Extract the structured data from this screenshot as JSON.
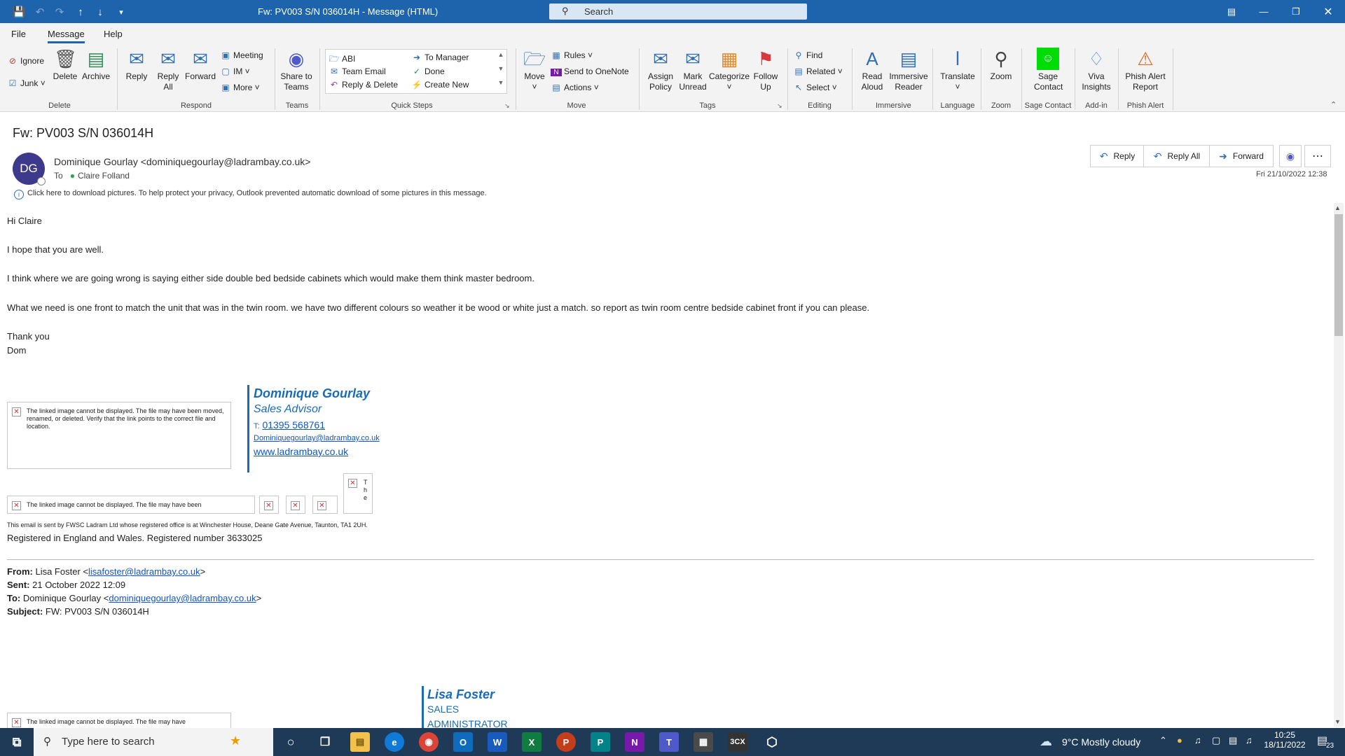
{
  "titlebar": {
    "title": "Fw: PV003 S/N 036014H  -  Message (HTML)",
    "search_placeholder": "Search"
  },
  "menu": {
    "tabs": [
      "File",
      "Message",
      "Help"
    ]
  },
  "ribbon": {
    "delete": {
      "ignore": "Ignore",
      "junk": "Junk",
      "delete": "Delete",
      "archive": "Archive",
      "label": "Delete"
    },
    "respond": {
      "reply": "Reply",
      "reply_all": "Reply All",
      "forward": "Forward",
      "meeting": "Meeting",
      "im": "IM",
      "more": "More",
      "label": "Respond"
    },
    "teams": {
      "share": "Share to Teams",
      "label": "Teams"
    },
    "quick_steps": {
      "abi": "ABI",
      "team_email": "Team Email",
      "reply_delete": "Reply & Delete",
      "to_manager": "To Manager",
      "done": "Done",
      "create_new": "Create New",
      "label": "Quick Steps"
    },
    "move": {
      "move": "Move",
      "rules": "Rules",
      "onenote": "Send to OneNote",
      "actions": "Actions",
      "label": "Move"
    },
    "tags": {
      "assign_policy": "Assign Policy",
      "mark_unread": "Mark Unread",
      "categorize": "Categorize",
      "follow_up": "Follow Up",
      "label": "Tags"
    },
    "editing": {
      "find": "Find",
      "related": "Related",
      "select": "Select",
      "label": "Editing"
    },
    "immersive": {
      "read_aloud": "Read Aloud",
      "immersive_reader": "Immersive Reader",
      "label": "Immersive"
    },
    "language": {
      "translate": "Translate",
      "label": "Language"
    },
    "zoom": {
      "zoom": "Zoom",
      "label": "Zoom"
    },
    "sage": {
      "contact": "Sage Contact",
      "label": "Sage Contact"
    },
    "addin": {
      "viva": "Viva Insights",
      "label": "Add-in"
    },
    "phish": {
      "report": "Phish Alert Report",
      "label": "Phish Alert"
    }
  },
  "message": {
    "subject": "Fw: PV003 S/N 036014H",
    "avatar_initials": "DG",
    "sender": "Dominique Gourlay <dominiquegourlay@ladrambay.co.uk>",
    "to_label": "To",
    "to_name": "Claire Folland",
    "date": "Fri 21/10/2022 12:38",
    "actions": {
      "reply": "Reply",
      "reply_all": "Reply All",
      "forward": "Forward"
    },
    "info": "Click here to download pictures. To help protect your privacy, Outlook prevented automatic download of some pictures in this message."
  },
  "body": {
    "greeting": "Hi Claire",
    "p1": "I hope that you are well.",
    "p2": "I think where we are going wrong is saying either side double bed bedside cabinets which would make them think master bedroom.",
    "p3": "What we need is one front to match the unit that was in the twin room. we have two different colours so weather it be wood or white just a match. so report as twin room centre bedside cabinet front if you can please.",
    "thanks": "Thank you",
    "signoff": "Dom",
    "broken_image_text": "The linked image cannot be displayed.  The file may have been moved, renamed, or deleted. Verify that the link points to the correct file and location.",
    "broken_image_short": "The linked image cannot be displayed.  The file may have been",
    "broken_image_short2": "The linked image cannot be displayed.  The file may have",
    "broken_image_letters": "T h e",
    "signature": {
      "name": "Dominique Gourlay",
      "title": "Sales Advisor",
      "tel_label": "T:",
      "tel": "01395 568761",
      "email": "Dominiquegourlay@ladrambay.co.uk",
      "web": "www.ladrambay.co.uk"
    },
    "disclaimer": "This email is sent by FWSC Ladram Ltd whose registered office is at Winchester House, Deane Gate Avenue, Taunton, TA1 2UH.",
    "registered": "Registered in England and Wales. Registered number 3633025",
    "fwd": {
      "from_label": "From:",
      "from_name": "Lisa Foster <",
      "from_email": "lisafoster@ladrambay.co.uk",
      "close": ">",
      "sent_label": "Sent:",
      "sent": "21 October 2022 12:09",
      "to_label": "To:",
      "to_name": "Dominique Gourlay <",
      "to_email": "dominiquegourlay@ladrambay.co.uk",
      "subject_label": "Subject:",
      "subject": "FW: PV003 S/N 036014H"
    },
    "signature2": {
      "name": "Lisa Foster",
      "title": "SALES",
      "title2": "ADMINISTRATOR"
    }
  },
  "taskbar": {
    "search_placeholder": "Type here to search",
    "weather": "9°C  Mostly cloudy",
    "time": "10:25",
    "date": "18/11/2022",
    "notifications": "23"
  },
  "colors": {
    "accent": "#1e64ad",
    "signature_blue": "#1a6bb8",
    "link": "#1155cc"
  }
}
